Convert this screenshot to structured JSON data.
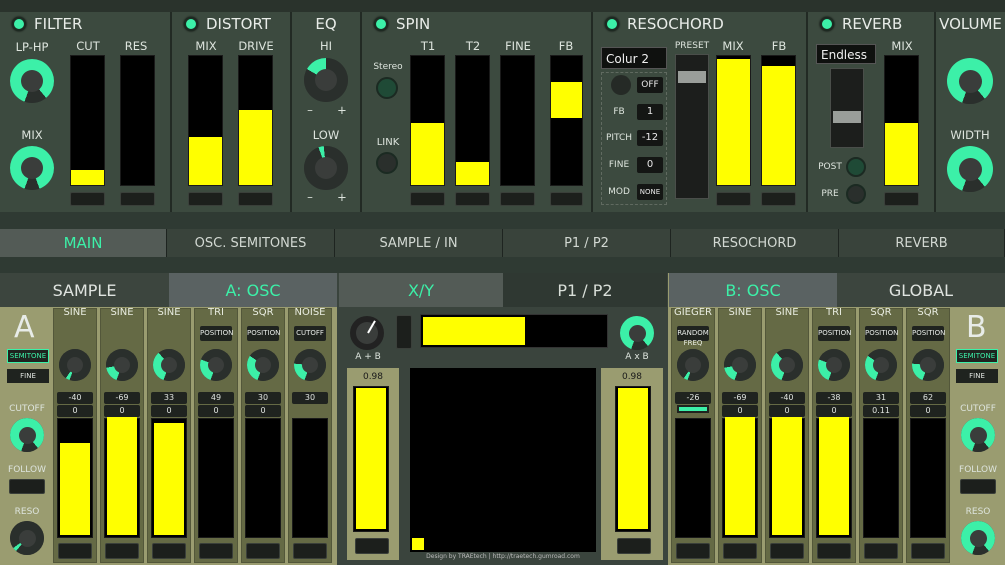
{
  "sections": {
    "filter": {
      "title": "FILTER",
      "knob1": "LP-HP",
      "knob2": "MIX",
      "fader1": "CUT",
      "fader2": "RES",
      "cut_level": 0.12,
      "res_level": 0
    },
    "distort": {
      "title": "DISTORT",
      "fader1": "MIX",
      "fader2": "DRIVE",
      "mix_level": 0.37,
      "drive_level": 0.58
    },
    "eq": {
      "title": "EQ",
      "hi": "HI",
      "low": "LOW",
      "minus": "–",
      "plus": "+"
    },
    "spin": {
      "title": "SPIN",
      "stereo": "Stereo",
      "link": "LINK",
      "f1": "T1",
      "f2": "T2",
      "f3": "FINE",
      "f4": "FB",
      "t1_level": 0.48,
      "t2_level": 0.18,
      "fine_level": 0,
      "fb_level": 0.28
    },
    "resochord": {
      "title": "RESOCHORD",
      "preset_select": "Colur 2",
      "off_label": "OFF",
      "fb_label": "FB",
      "fb_value": "1",
      "pitch_label": "PITCH",
      "pitch_value": "-12",
      "fine_label": "FINE",
      "fine_value": "0",
      "mod_label": "MOD",
      "mod_value": "NONE",
      "preset": "PRESET",
      "mix": "MIX",
      "fb2": "FB",
      "mix_level": 0.98,
      "fb_level": 0.92
    },
    "reverb": {
      "title": "REVERB",
      "preset_select": "Endless",
      "mix": "MIX",
      "post": "POST",
      "pre": "PRE",
      "mix_level": 0.48
    },
    "volume": {
      "title": "VOLUME",
      "width": "WIDTH"
    }
  },
  "tabs": [
    {
      "label": "MAIN"
    },
    {
      "label": "OSC. SEMITONES"
    },
    {
      "label": "SAMPLE / IN"
    },
    {
      "label": "P1 / P2"
    },
    {
      "label": "RESOCHORD"
    },
    {
      "label": "REVERB"
    }
  ],
  "oscA": {
    "tab_sample": "SAMPLE",
    "tab_osc": "A: OSC",
    "letter": "A",
    "semitone": "SEMITONE",
    "fine": "FINE",
    "cutoff": "CUTOFF",
    "follow": "FOLLOW",
    "reso": "RESO",
    "channels": [
      {
        "title": "SINE",
        "mode": "",
        "v1": "-40",
        "v2": "0",
        "level": 0.78
      },
      {
        "title": "SINE",
        "mode": "",
        "v1": "-69",
        "v2": "0",
        "level": 1.0
      },
      {
        "title": "SINE",
        "mode": "",
        "v1": "33",
        "v2": "0",
        "level": 0.95
      },
      {
        "title": "TRI",
        "mode": "POSITION",
        "v1": "49",
        "v2": "0",
        "level": 0
      },
      {
        "title": "SQR",
        "mode": "POSITION",
        "v1": "30",
        "v2": "0",
        "level": 0
      },
      {
        "title": "NOISE",
        "mode": "CUTOFF",
        "v1": "30",
        "v2": "",
        "level": 0
      }
    ]
  },
  "xy": {
    "tab_xy": "X/Y",
    "tab_p1p2": "P1 / P2",
    "a_plus_b": "A + B",
    "a_x_b": "A x B",
    "level_a": 0.98,
    "level_b": 0.98,
    "footer": "Design by TRAEtech  |  http://traetech.gumroad.com",
    "mix_level": 0.55
  },
  "oscB": {
    "tab_osc": "B: OSC",
    "tab_global": "GLOBAL",
    "letter": "B",
    "semitone": "SEMITONE",
    "fine": "FINE",
    "cutoff": "CUTOFF",
    "follow": "FOLLOW",
    "reso": "RESO",
    "channels": [
      {
        "title": "GIEGER",
        "mode": "RANDOM",
        "sub": "FREQ",
        "v1": "-26",
        "v2": "",
        "level": 0
      },
      {
        "title": "SINE",
        "mode": "",
        "v1": "-69",
        "v2": "0",
        "level": 1.0
      },
      {
        "title": "SINE",
        "mode": "",
        "v1": "-40",
        "v2": "0",
        "level": 1.0
      },
      {
        "title": "TRI",
        "mode": "POSITION",
        "v1": "-38",
        "v2": "0",
        "level": 1.0
      },
      {
        "title": "SQR",
        "mode": "POSITION",
        "v1": "31",
        "v2": "0.11",
        "level": 0
      },
      {
        "title": "SQR",
        "mode": "POSITION",
        "v1": "62",
        "v2": "0",
        "level": 0
      }
    ]
  },
  "colors": {
    "accent": "#3cf0a8",
    "fader": "#ffff00"
  }
}
